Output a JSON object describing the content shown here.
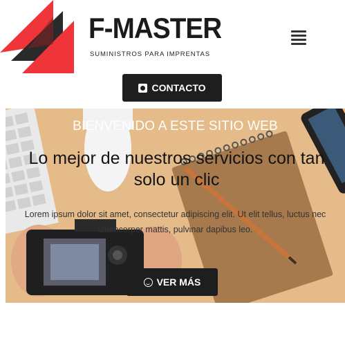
{
  "brand": {
    "title": "F-MASTER",
    "subtitle": "SUMINISTROS PARA IMPRENTAS",
    "colors": {
      "red": "#f0353a",
      "dark": "#2a2a2a"
    }
  },
  "header": {
    "menu_icon": "hamburger-menu-icon",
    "contact_label": "CONTACTO",
    "contact_icon": "phone-icon"
  },
  "hero": {
    "kicker": "BIENVENIDO A ESTE SITIO WEB",
    "title": "Lo mejor de nuestros servicios con tan solo un clic",
    "text": "Lorem ipsum dolor sit amet, consectetur adipiscing elit. Ut elit tellus, luctus nec ullamcorper mattis, pulvinar dapibus leo.",
    "button_label": "VER MÁS",
    "button_icon": "smile-icon"
  }
}
